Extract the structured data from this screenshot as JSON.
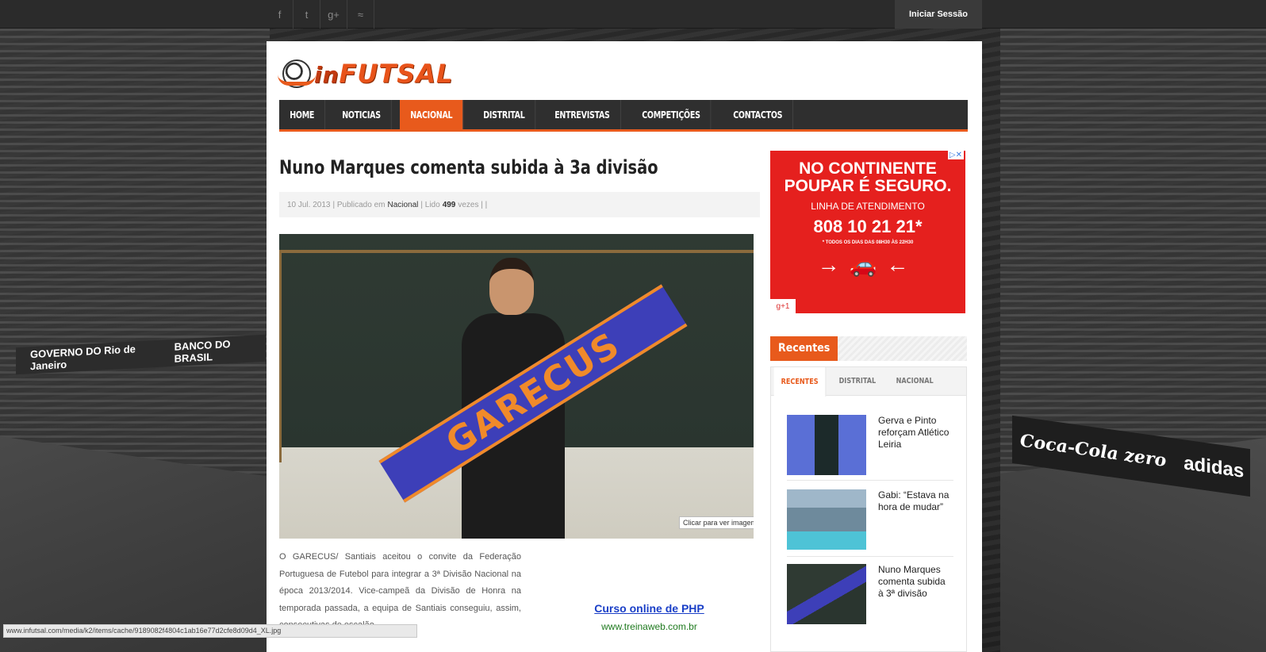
{
  "topbar": {
    "social": [
      "f",
      "t",
      "g+",
      "rss"
    ],
    "login_label": "Iniciar Sessão"
  },
  "site": {
    "logo_text_in": "in",
    "logo_text_futsal": "FUTSAL"
  },
  "nav": {
    "items": [
      {
        "label": "HOME"
      },
      {
        "label": "NOTICIAS"
      },
      {
        "label": "NACIONAL",
        "active": true
      },
      {
        "label": "DISTRITAL"
      },
      {
        "label": "ENTREVISTAS"
      },
      {
        "label": "COMPETIÇÕES"
      },
      {
        "label": "CONTACTOS"
      }
    ]
  },
  "article": {
    "title": "Nuno Marques comenta subida à 3a divisão",
    "meta": {
      "date": "10 Jul. 2013",
      "published_prefix": "| Publicado em",
      "category": "Nacional",
      "read_prefix": "| Lido",
      "read_count": "499",
      "read_suffix": "vezes | |"
    },
    "image_tooltip": "Clicar para ver imagem",
    "scarf_text": "GARECUS",
    "body": "O GARECUS/ Santiais aceitou o convite da Federação Portuguesa de Futebol para integrar a 3ª Divisão Nacional na época 2013/2014. Vice-campeã da Divisão de Honra na temporada passada, a equipa de Santiais conseguiu, assim, consecutivas de escalão."
  },
  "text_ad": {
    "link": "Curso online de PHP",
    "url": "www.treinaweb.com.br"
  },
  "sidebar_ad": {
    "line1": "NO CONTINENTE",
    "line2": "POUPAR É SEGURO.",
    "line3": "LINHA DE ATENDIMENTO",
    "phone": "808 10 21 21*",
    "note": "* TODOS OS DIAS DAS 08H30 ÀS 22H30",
    "g1": "g+1"
  },
  "recentes": {
    "heading": "Recentes",
    "tabs": [
      {
        "label": "RECENTES",
        "active": true
      },
      {
        "label": "DISTRITAL"
      },
      {
        "label": "NACIONAL"
      }
    ],
    "posts": [
      {
        "title": "Gerva e Pinto reforçam Atlético Leiria"
      },
      {
        "title": "Gabi: “Estava na hora de mudar”"
      },
      {
        "title": "Nuno Marques comenta subida à 3ª divisão"
      }
    ]
  },
  "background": {
    "banner_left": [
      "GOVERNO DO Rio de Janeiro",
      "BANCO DO BRASIL"
    ],
    "banner_right": [
      "Coca-Cola zero",
      "adidas"
    ]
  },
  "statusbar": {
    "url": "www.infutsal.com/media/k2/items/cache/9189082f4804c1ab16e77d2cfe8d09d4_XL.jpg"
  },
  "colors": {
    "accent": "#e85a1c",
    "nav_bg": "#2f2f2f",
    "ad_red": "#e5201e"
  }
}
